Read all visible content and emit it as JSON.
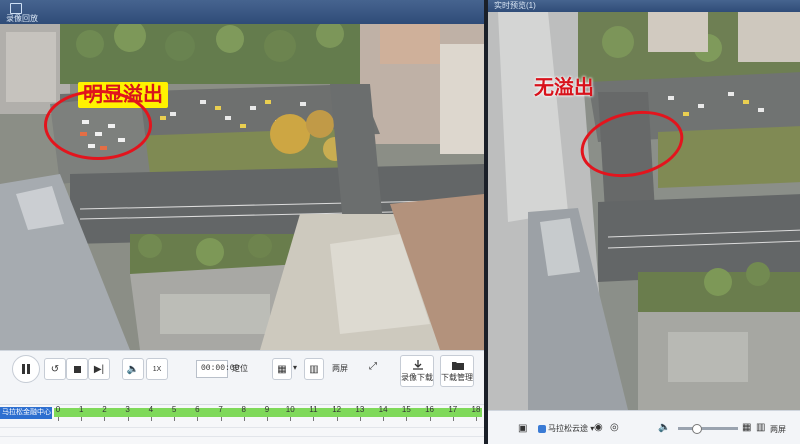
{
  "left": {
    "title": "录像回放",
    "annotation": "明显溢出",
    "controls": {
      "time_value": "00:00:00",
      "locate_label": "定位",
      "speed_label": "1X",
      "split_label": "两屏",
      "record_download_label": "录像下载",
      "download_manage_label": "下载管理"
    },
    "timeline": {
      "channel_label": "马拉松金融中心",
      "ticks": [
        "0",
        "1",
        "2",
        "3",
        "4",
        "5",
        "6",
        "7",
        "8",
        "9",
        "10",
        "11",
        "12",
        "13",
        "14",
        "15",
        "16",
        "17",
        "18"
      ]
    }
  },
  "right": {
    "title": "实时预览(1)",
    "annotation": "无溢出",
    "bottombar": {
      "channel_name": "马拉松云途",
      "split_label": "两屏"
    }
  },
  "colors": {
    "annotation_red": "#e3141d",
    "annotation_bg": "#fff200",
    "timeline_green": "#7fd95a",
    "titlebar_blue": "#2f4c78"
  }
}
